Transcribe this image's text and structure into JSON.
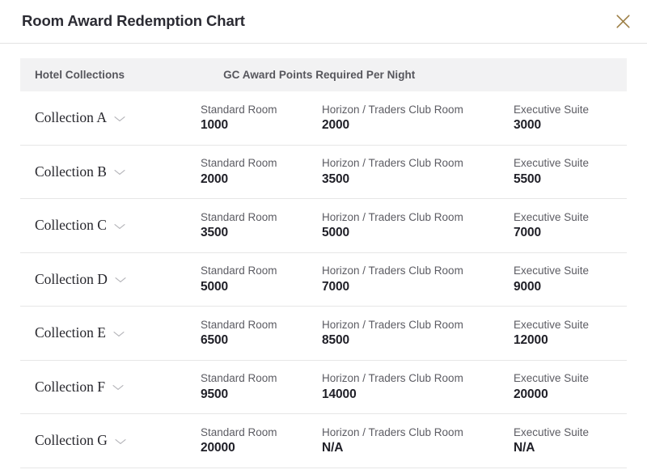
{
  "dialog": {
    "title": "Room Award Redemption Chart",
    "close_label": "Close",
    "close_icon": "close-icon",
    "close_icon_color": "#9a7b3f"
  },
  "table": {
    "headers": {
      "collections": "Hotel Collections",
      "points": "GC Award Points Required Per Night"
    },
    "chevron_icon": "chevron-down-icon",
    "room_types": {
      "standard": "Standard Room",
      "horizon": "Horizon / Traders Club Room",
      "executive": "Executive Suite"
    },
    "rows": [
      {
        "collection": "Collection A",
        "standard_label": "Standard Room",
        "standard_value": "1000",
        "horizon_label": "Horizon / Traders Club Room",
        "horizon_value": "2000",
        "executive_label": "Executive Suite",
        "executive_value": "3000"
      },
      {
        "collection": "Collection B",
        "standard_label": "Standard Room",
        "standard_value": "2000",
        "horizon_label": "Horizon / Traders Club Room",
        "horizon_value": "3500",
        "executive_label": "Executive Suite",
        "executive_value": "5500"
      },
      {
        "collection": "Collection C",
        "standard_label": "Standard Room",
        "standard_value": "3500",
        "horizon_label": "Horizon / Traders Club Room",
        "horizon_value": "5000",
        "executive_label": "Executive Suite",
        "executive_value": "7000"
      },
      {
        "collection": "Collection D",
        "standard_label": "Standard Room",
        "standard_value": "5000",
        "horizon_label": "Horizon / Traders Club Room",
        "horizon_value": "7000",
        "executive_label": "Executive Suite",
        "executive_value": "9000"
      },
      {
        "collection": "Collection E",
        "standard_label": "Standard Room",
        "standard_value": "6500",
        "horizon_label": "Horizon / Traders Club Room",
        "horizon_value": "8500",
        "executive_label": "Executive Suite",
        "executive_value": "12000"
      },
      {
        "collection": "Collection F",
        "standard_label": "Standard Room",
        "standard_value": "9500",
        "horizon_label": "Horizon / Traders Club Room",
        "horizon_value": "14000",
        "executive_label": "Executive Suite",
        "executive_value": "20000"
      },
      {
        "collection": "Collection G",
        "standard_label": "Standard Room",
        "standard_value": "20000",
        "horizon_label": "Horizon / Traders Club Room",
        "horizon_value": "N/A",
        "executive_label": "Executive Suite",
        "executive_value": "N/A"
      }
    ]
  }
}
